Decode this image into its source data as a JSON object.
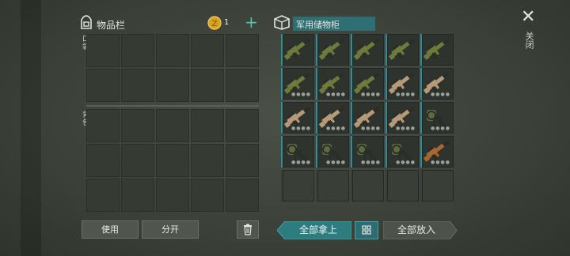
{
  "inventory": {
    "title": "物品栏",
    "pocket_label": "口袋",
    "backpack_label": "背包",
    "coins": "1",
    "use_label": "使用",
    "split_label": "分开"
  },
  "storage": {
    "title": "军用储物柜",
    "take_all_label": "全部拿上",
    "put_all_label": "全部放入",
    "close_label": "关闭",
    "items": [
      {
        "kind": "rifle-green",
        "name": "rifle-item"
      },
      {
        "kind": "rifle-green",
        "name": "rifle-item"
      },
      {
        "kind": "rifle-green",
        "name": "rifle-item"
      },
      {
        "kind": "rifle-green",
        "name": "rifle-item"
      },
      {
        "kind": "rifle-green",
        "name": "rifle-item"
      },
      {
        "kind": "rifle-green",
        "name": "rifle-item"
      },
      {
        "kind": "rifle-green",
        "name": "rifle-item"
      },
      {
        "kind": "rifle-green",
        "name": "rifle-item"
      },
      {
        "kind": "rifle-tan",
        "name": "rifle-item"
      },
      {
        "kind": "rifle-tan",
        "name": "rifle-item"
      },
      {
        "kind": "rifle-tan",
        "name": "rifle-item"
      },
      {
        "kind": "rifle-tan",
        "name": "rifle-item"
      },
      {
        "kind": "rifle-tan",
        "name": "rifle-item"
      },
      {
        "kind": "rifle-tan",
        "name": "rifle-item"
      },
      {
        "kind": "launcher",
        "name": "launcher-item"
      },
      {
        "kind": "launcher",
        "name": "launcher-item"
      },
      {
        "kind": "launcher",
        "name": "launcher-item"
      },
      {
        "kind": "launcher",
        "name": "launcher-item"
      },
      {
        "kind": "launcher",
        "name": "launcher-item"
      },
      {
        "kind": "rifle-wood",
        "name": "rifle-item"
      }
    ]
  },
  "colors": {
    "accent": "#2f8f98",
    "background": "#3d4339",
    "plus": "#4fc3b8"
  }
}
